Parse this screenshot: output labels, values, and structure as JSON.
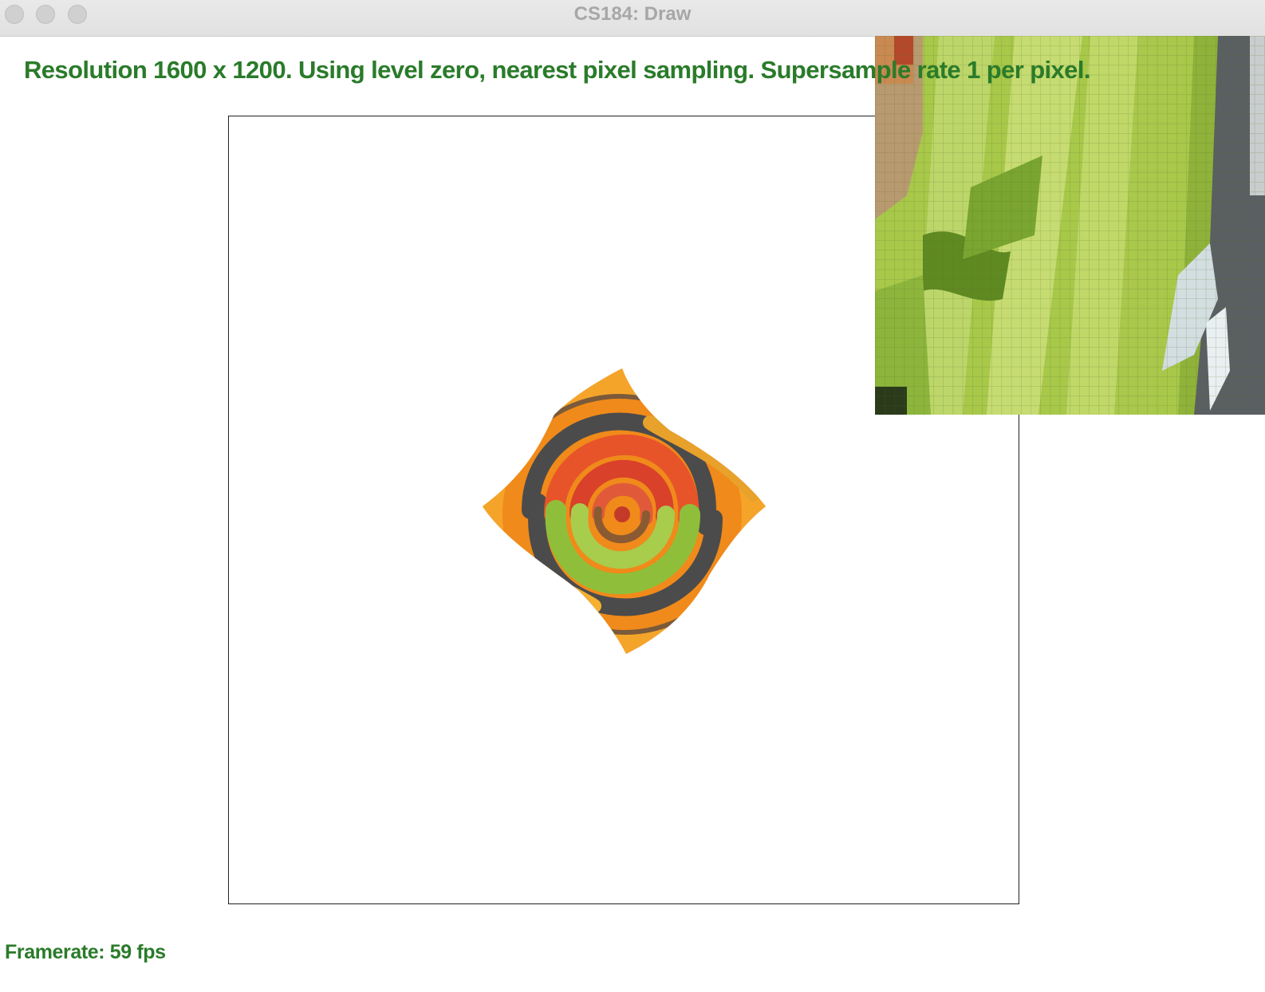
{
  "window": {
    "title": "CS184: Draw",
    "controls": [
      "close-button",
      "minimize-button",
      "zoom-button"
    ]
  },
  "status": {
    "text": "Resolution 1600 x 1200. Using level zero, nearest pixel sampling. Supersample rate 1 per pixel."
  },
  "footer": {
    "framerate": "Framerate: 59 fps"
  },
  "colors": {
    "status_text": "#2a7b2a",
    "titlebar": "#e4e4e5",
    "title_text": "#a7a7a7",
    "frame_border": "#222222"
  }
}
